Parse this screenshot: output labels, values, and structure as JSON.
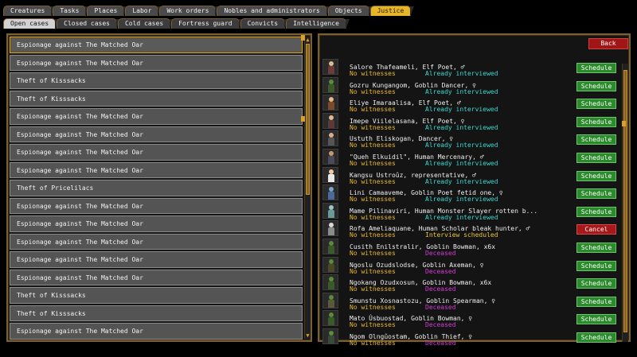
{
  "tabs_main": [
    {
      "label": "Creatures",
      "active": false
    },
    {
      "label": "Tasks",
      "active": false
    },
    {
      "label": "Places",
      "active": false
    },
    {
      "label": "Labor",
      "active": false
    },
    {
      "label": "Work orders",
      "active": false
    },
    {
      "label": "Nobles and administrators",
      "active": false
    },
    {
      "label": "Objects",
      "active": false
    },
    {
      "label": "Justice",
      "active": true
    }
  ],
  "tabs_sub": [
    {
      "label": "Open cases",
      "active": true
    },
    {
      "label": "Closed cases",
      "active": false
    },
    {
      "label": "Cold cases",
      "active": false
    },
    {
      "label": "Fortress guard",
      "active": false
    },
    {
      "label": "Convicts",
      "active": false
    },
    {
      "label": "Intelligence",
      "active": false
    }
  ],
  "cases": [
    "Espionage against The Matched Oar",
    "Espionage against The Matched Oar",
    "Theft of Kisssacks",
    "Theft of Kisssacks",
    "Espionage against The Matched Oar",
    "Espionage against The Matched Oar",
    "Espionage against The Matched Oar",
    "Espionage against The Matched Oar",
    "Theft of Pricelilacs",
    "Espionage against The Matched Oar",
    "Espionage against The Matched Oar",
    "Espionage against The Matched Oar",
    "Espionage against The Matched Oar",
    "Espionage against The Matched Oar",
    "Theft of Kisssacks",
    "Theft of Kisssacks",
    "Espionage against The Matched Oar"
  ],
  "back_label": "Back",
  "suspects": [
    {
      "name": "Salore Thafeameli, Elf Poet, ♂",
      "witness": "No witnesses",
      "status": "Already interviewed",
      "status_kind": "interviewed",
      "button": "Schedule",
      "head": "#e3b98a",
      "body": "#6a3c3c"
    },
    {
      "name": "Gozru Kungangom, Goblin Dancer, ♀",
      "witness": "No witnesses",
      "status": "Already interviewed",
      "status_kind": "interviewed",
      "button": "Schedule",
      "head": "#5a8a3a",
      "body": "#3a5a2a"
    },
    {
      "name": "Eliye Imaraalisa, Elf Poet, ♂",
      "witness": "No witnesses",
      "status": "Already interviewed",
      "status_kind": "interviewed",
      "button": "Schedule",
      "head": "#e3b98a",
      "body": "#7a4a2a"
    },
    {
      "name": "Imepe Viilelasana, Elf Poet, ♀",
      "witness": "No witnesses",
      "status": "Already interviewed",
      "status_kind": "interviewed",
      "button": "Schedule",
      "head": "#e3b98a",
      "body": "#5a3a3a"
    },
    {
      "name": "Ustuth Eliskogan, Dancer, ♀",
      "witness": "No witnesses",
      "status": "Already interviewed",
      "status_kind": "interviewed",
      "button": "Schedule",
      "head": "#d8b090",
      "body": "#555555"
    },
    {
      "name": "\"Queh Elkuidil\", Human Mercenary, ♂",
      "witness": "No witnesses",
      "status": "Already interviewed",
      "status_kind": "interviewed",
      "button": "Schedule",
      "head": "#c89870",
      "body": "#4a4a5a"
    },
    {
      "name": "Kangsu Ustroûz, representative, ♂",
      "witness": "No witnesses",
      "status": "Already interviewed",
      "status_kind": "interviewed",
      "button": "Schedule",
      "head": "#f0c8a8",
      "body": "#e8e8e8"
    },
    {
      "name": "Lini Camaaveme, Goblin Poet fetid one, ♀",
      "witness": "No witnesses",
      "status": "Already interviewed",
      "status_kind": "interviewed",
      "button": "Schedule",
      "head": "#7aa0c8",
      "body": "#4a6a9a"
    },
    {
      "name": "Mame Pilinaviri, Human Monster Slayer rotten b...",
      "witness": "No witnesses",
      "status": "Already interviewed",
      "status_kind": "interviewed",
      "button": "Schedule",
      "head": "#9ac8c8",
      "body": "#6a9a9a"
    },
    {
      "name": "Rofa Ameliaquane, Human Scholar bleak hunter, ♂",
      "witness": "No witnesses",
      "status": "Interview scheduled",
      "status_kind": "scheduled",
      "button": "Cancel",
      "head": "#d8d8d8",
      "body": "#8a8a8a"
    },
    {
      "name": "Cusith Enilstralir, Goblin Bowman, x6x",
      "witness": "No witnesses",
      "status": "Deceased",
      "status_kind": "deceased",
      "button": "Schedule",
      "head": "#5a8a3a",
      "body": "#3a5a2a"
    },
    {
      "name": "Ngoslu Ozudslodse, Goblin Axeman, ♀",
      "witness": "No witnesses",
      "status": "Deceased",
      "status_kind": "deceased",
      "button": "Schedule",
      "head": "#5a8a3a",
      "body": "#4a4a2a"
    },
    {
      "name": "Ngokang Ozudxosun, Goblin Bowman, x6x",
      "witness": "No witnesses",
      "status": "Deceased",
      "status_kind": "deceased",
      "button": "Schedule",
      "head": "#5a8a3a",
      "body": "#3a5a2a"
    },
    {
      "name": "Smunstu Xosnastozu, Goblin Spearman, ♀",
      "witness": "No witnesses",
      "status": "Deceased",
      "status_kind": "deceased",
      "button": "Schedule",
      "head": "#5a8a3a",
      "body": "#5a5a3a"
    },
    {
      "name": "Mato Ûsbuostad, Goblin Bowman, ♀",
      "witness": "No witnesses",
      "status": "Deceased",
      "status_kind": "deceased",
      "button": "Schedule",
      "head": "#5a8a3a",
      "body": "#3a5a2a"
    },
    {
      "name": "Ngom Olngûostam, Goblin Thief, ♀",
      "witness": "No witnesses",
      "status": "Deceased",
      "status_kind": "deceased",
      "button": "Schedule",
      "head": "#5a8a3a",
      "body": "#3a4a3a"
    }
  ]
}
